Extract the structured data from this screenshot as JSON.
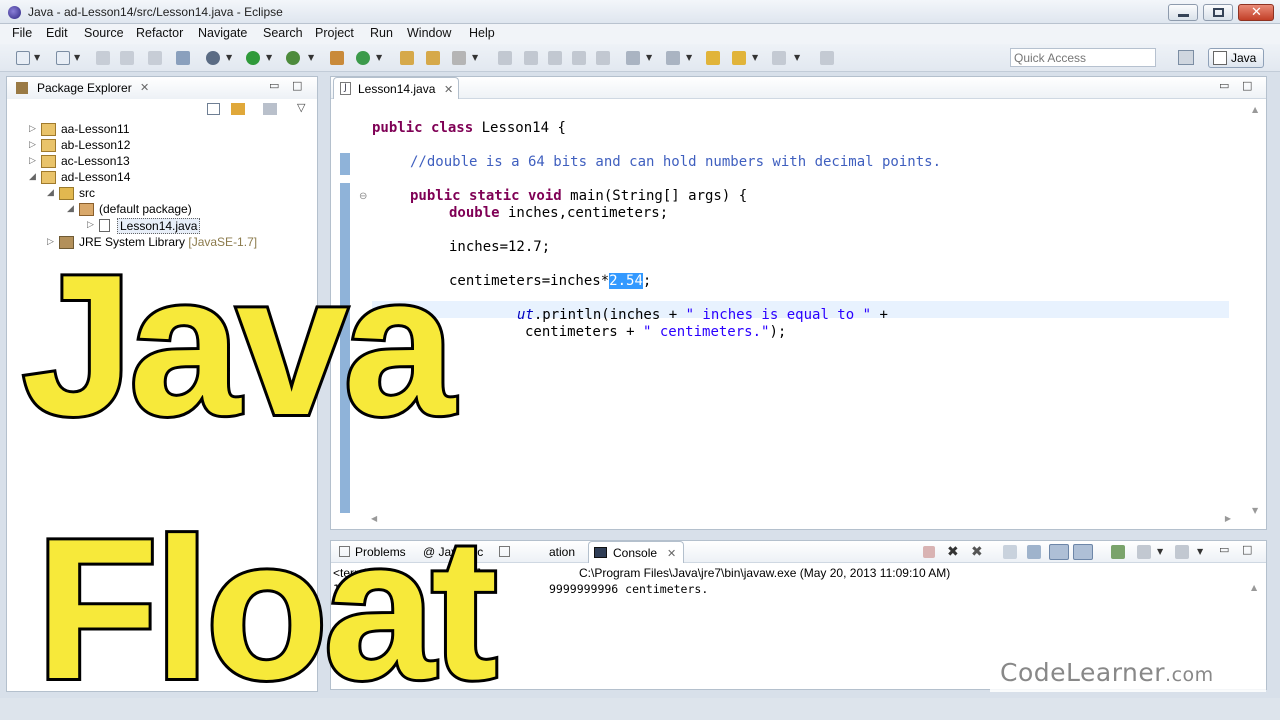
{
  "window": {
    "title": "Java - ad-Lesson14/src/Lesson14.java - Eclipse",
    "close_glyph": "✕"
  },
  "menu": [
    "File",
    "Edit",
    "Source",
    "Refactor",
    "Navigate",
    "Search",
    "Project",
    "Run",
    "Window",
    "Help"
  ],
  "toolbar": {
    "quick_access_placeholder": "Quick Access",
    "perspective_label": "Java"
  },
  "package_explorer": {
    "tab_label": "Package Explorer",
    "tree": [
      {
        "label": "aa-Lesson11",
        "twisty": "▷",
        "icon": "project-folder-icon"
      },
      {
        "label": "ab-Lesson12",
        "twisty": "▷",
        "icon": "project-folder-icon"
      },
      {
        "label": "ac-Lesson13",
        "twisty": "▷",
        "icon": "project-folder-icon"
      },
      {
        "label": "ad-Lesson14",
        "twisty": "◢",
        "icon": "project-folder-icon"
      },
      {
        "label": "src",
        "twisty": "◢",
        "icon": "source-folder-icon"
      },
      {
        "label": "(default package)",
        "twisty": "◢",
        "icon": "package-icon"
      },
      {
        "label": "Lesson14.java",
        "twisty": "▷",
        "icon": "java-file-icon"
      },
      {
        "label": "JRE System Library",
        "decoration": "[JavaSE-1.7]",
        "twisty": "▷",
        "icon": "library-icon"
      }
    ]
  },
  "editor": {
    "tab_label": "Lesson14.java",
    "file_icon_glyph": "J",
    "code": {
      "l1_kw": "public class",
      "l1_rest": " Lesson14 {",
      "l2_comment": "//double is a 64 bits and can hold numbers with decimal points.",
      "l3_kw": "public static void",
      "l3_rest": " main(String[] args) {",
      "l4_kw": "double",
      "l4_rest": " inches,centimeters;",
      "l5": "inches=12.7;",
      "l6_pre": "centimeters=inches*",
      "l6_sel": "2.54",
      "l6_post": ";",
      "l7_field": "ut",
      "l7_mid": ".println(inches + ",
      "l7_str": "\" inches is equal to \"",
      "l7_end": " +",
      "l8_pre": "centimeters + ",
      "l8_str": "\" centimeters.\"",
      "l8_end": ");",
      "close_brace": "}"
    }
  },
  "console": {
    "tabs": [
      "Problems",
      "@ Javadoc",
      "ation",
      "Console"
    ],
    "active_tab": "Console",
    "header_left": "<termin",
    "header_mid": "Jav",
    "header_path": "C:\\Program Files\\Java\\jre7\\bin\\javaw.exe (May 20, 2013 11:09:10 AM)",
    "output_left": "12.7",
    "output_mid": "l",
    "output_right": "9999999996 centimeters."
  },
  "overlay": {
    "line1": "Java",
    "line2": "Float"
  },
  "brand": {
    "name": "CodeLearner",
    "suffix": ".com"
  },
  "colors": {
    "keyword": "#7f0055",
    "comment": "#3f5fbf",
    "string": "#2a00ff",
    "selection": "#3399ff",
    "overlay_fill": "#f7e93a"
  }
}
